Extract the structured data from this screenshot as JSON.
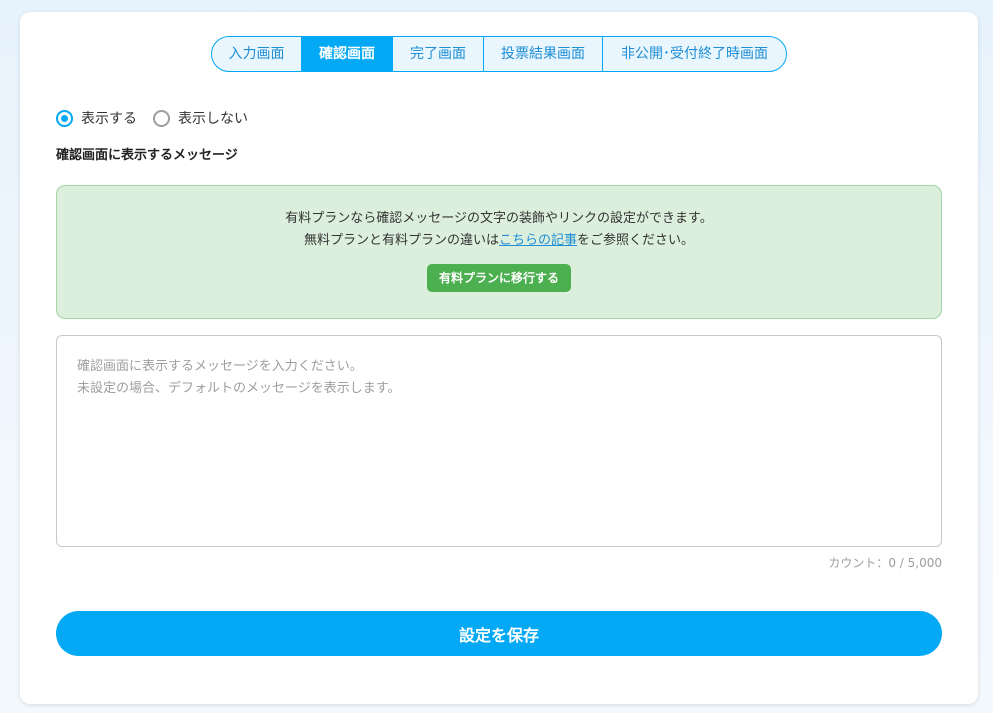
{
  "tabs": [
    {
      "label": "入力画面",
      "active": false
    },
    {
      "label": "確認画面",
      "active": true
    },
    {
      "label": "完了画面",
      "active": false
    },
    {
      "label": "投票結果画面",
      "active": false
    },
    {
      "label": "非公開･受付終了時画面",
      "active": false
    }
  ],
  "display_option": {
    "show_label": "表示する",
    "hide_label": "表示しない",
    "selected": "show"
  },
  "section_label": "確認画面に表示するメッセージ",
  "notice": {
    "line1": "有料プランなら確認メッセージの文字の装飾やリンクの設定ができます。",
    "line2_before": "無料プランと有料プランの違いは",
    "line2_link": "こちらの記事",
    "line2_after": "をご参照ください。",
    "button_label": "有料プランに移行する"
  },
  "message_input": {
    "value": "",
    "placeholder": "確認画面に表示するメッセージを入力ください。\n未設定の場合、デフォルトのメッセージを表示します。"
  },
  "counter": {
    "prefix": "カウント：",
    "current": "0",
    "separator": " / ",
    "max": "5,000"
  },
  "save_button_label": "設定を保存",
  "colors": {
    "accent": "#03a9f4",
    "notice_bg": "#dcefdc",
    "upgrade_green": "#4caf50"
  }
}
